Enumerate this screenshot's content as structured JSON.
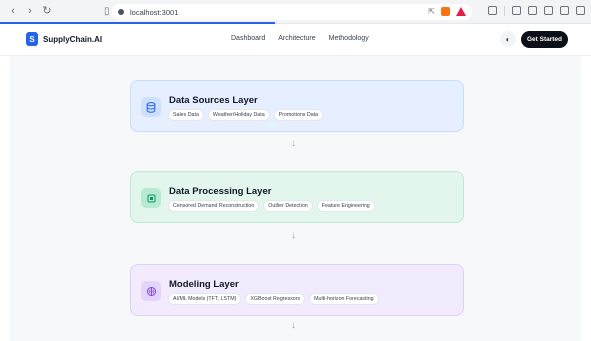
{
  "browser": {
    "url": "localhost:3001"
  },
  "header": {
    "logo_letter": "S",
    "brand": "SupplyChain.AI",
    "nav": [
      "Dashboard",
      "Architecture",
      "Methodology"
    ],
    "cta_label": "Get Started"
  },
  "layers": [
    {
      "title": "Data Sources Layer",
      "icon": "database-icon",
      "accent": "#2563eb",
      "tags": [
        "Sales Data",
        "Weather/Holiday Data",
        "Promotions Data"
      ]
    },
    {
      "title": "Data Processing Layer",
      "icon": "cpu-icon",
      "accent": "#059669",
      "tags": [
        "Censored Demand Reconstruction",
        "Outlier Detection",
        "Feature Engineering"
      ]
    },
    {
      "title": "Modeling Layer",
      "icon": "brain-icon",
      "accent": "#7c3aed",
      "tags": [
        "AI/ML Models (TFT, LSTM)",
        "XGBoost Regressors",
        "Multi-horizon Forecasting"
      ]
    }
  ]
}
